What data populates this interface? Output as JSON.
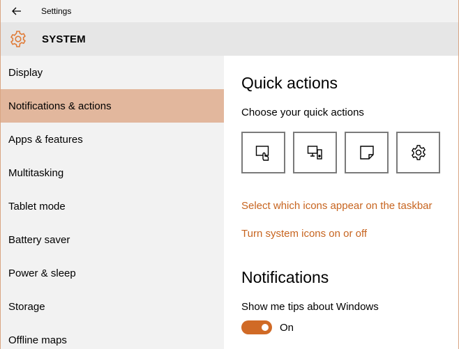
{
  "window": {
    "title": "Settings",
    "back_icon": "back-arrow-icon"
  },
  "header": {
    "title": "SYSTEM",
    "icon": "gear-icon",
    "accent": "#e07a36"
  },
  "sidebar": {
    "items": [
      {
        "label": "Display",
        "selected": false
      },
      {
        "label": "Notifications & actions",
        "selected": true
      },
      {
        "label": "Apps & features",
        "selected": false
      },
      {
        "label": "Multitasking",
        "selected": false
      },
      {
        "label": "Tablet mode",
        "selected": false
      },
      {
        "label": "Battery saver",
        "selected": false
      },
      {
        "label": "Power & sleep",
        "selected": false
      },
      {
        "label": "Storage",
        "selected": false
      },
      {
        "label": "Offline maps",
        "selected": false
      }
    ]
  },
  "main": {
    "quick_actions_title": "Quick actions",
    "quick_actions_subtitle": "Choose your quick actions",
    "tiles": [
      {
        "icon": "tablet-mode-icon"
      },
      {
        "icon": "project-icon"
      },
      {
        "icon": "note-icon"
      },
      {
        "icon": "settings-gear-icon"
      }
    ],
    "link_taskbar_icons": "Select which icons appear on the taskbar",
    "link_system_icons": "Turn system icons on or off",
    "notifications_title": "Notifications",
    "tips_label": "Show me tips about Windows",
    "tips_toggle": {
      "state": "On",
      "on": true,
      "color": "#d06a26"
    },
    "link_color": "#c7641f"
  }
}
